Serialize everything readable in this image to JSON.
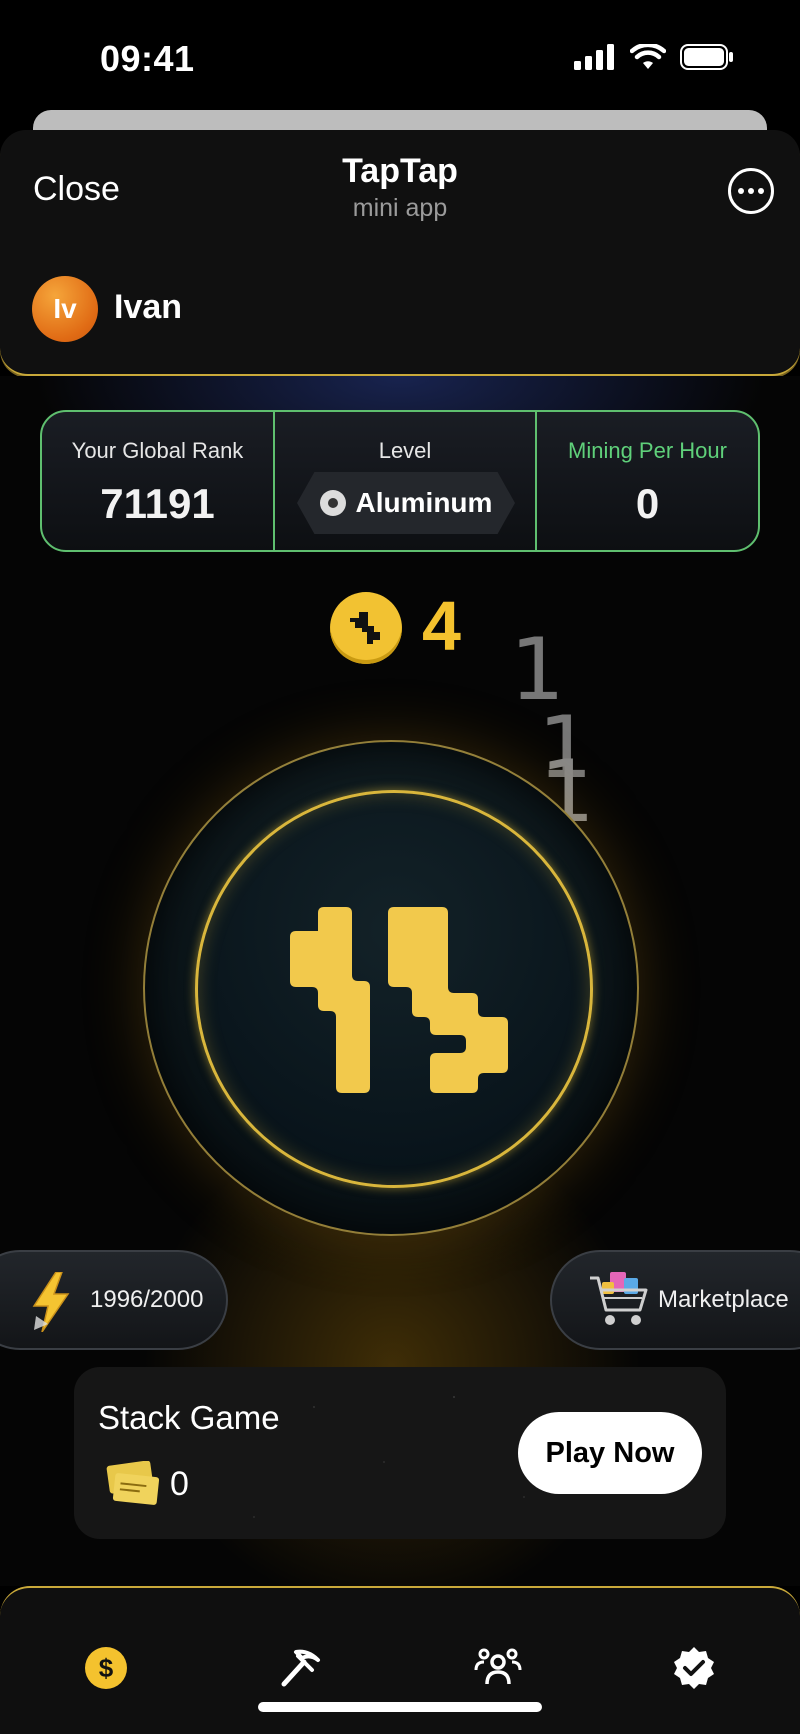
{
  "status_bar": {
    "time": "09:41"
  },
  "header": {
    "close_label": "Close",
    "title": "TapTap",
    "subtitle": "mini app",
    "user": {
      "initials": "Iv",
      "name": "Ivan"
    }
  },
  "stats": {
    "rank_label": "Your Global Rank",
    "rank_value": "71191",
    "level_label": "Level",
    "level_value": "Aluminum",
    "mining_label": "Mining Per Hour",
    "mining_value": "0"
  },
  "balance": {
    "value": "4"
  },
  "tap_effects": [
    "1",
    "1",
    "1"
  ],
  "energy": {
    "value": "1996/2000"
  },
  "marketplace": {
    "label": "Marketplace"
  },
  "stack_game": {
    "title": "Stack Game",
    "tickets": "0",
    "play_label": "Play Now"
  },
  "nav": {
    "items": [
      {
        "icon": "dollar-coin-icon",
        "active": true
      },
      {
        "icon": "pickaxe-icon",
        "active": false
      },
      {
        "icon": "friends-icon",
        "active": false
      },
      {
        "icon": "verified-check-icon",
        "active": false
      }
    ]
  },
  "colors": {
    "accent": "#f4c22e",
    "green": "#5fbf6f",
    "background": "#000000"
  }
}
